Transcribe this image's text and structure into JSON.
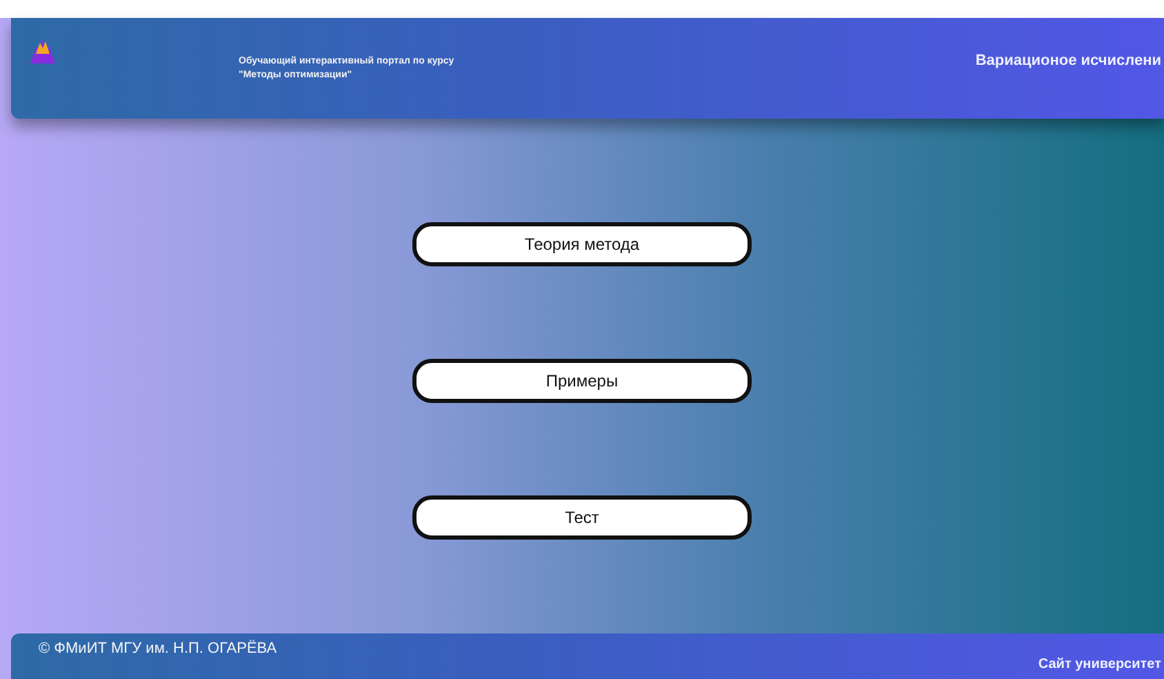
{
  "header": {
    "tagline": [
      "Обучающий интерактивный портал по курсу",
      "\"Методы оптимизации\""
    ],
    "section_title": "Вариационое исчислени"
  },
  "menu": [
    "Теория метода",
    "Примеры",
    "Тест"
  ],
  "footer": {
    "copyright": "© ФМиИТ МГУ им. Н.П. ОГАРЁВА",
    "link": "Сайт университет"
  }
}
